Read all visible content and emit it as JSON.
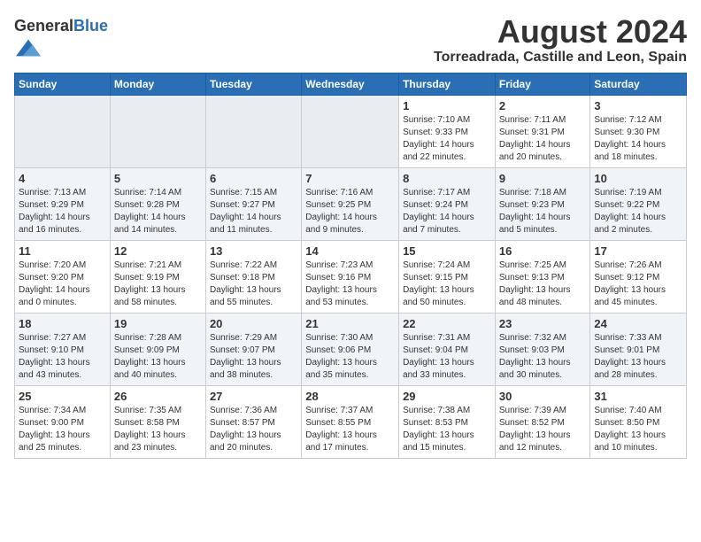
{
  "header": {
    "logo_general": "General",
    "logo_blue": "Blue",
    "month_year": "August 2024",
    "location": "Torreadrada, Castille and Leon, Spain"
  },
  "calendar": {
    "days_of_week": [
      "Sunday",
      "Monday",
      "Tuesday",
      "Wednesday",
      "Thursday",
      "Friday",
      "Saturday"
    ],
    "weeks": [
      [
        {
          "day": "",
          "info": ""
        },
        {
          "day": "",
          "info": ""
        },
        {
          "day": "",
          "info": ""
        },
        {
          "day": "",
          "info": ""
        },
        {
          "day": "1",
          "info": "Sunrise: 7:10 AM\nSunset: 9:33 PM\nDaylight: 14 hours\nand 22 minutes."
        },
        {
          "day": "2",
          "info": "Sunrise: 7:11 AM\nSunset: 9:31 PM\nDaylight: 14 hours\nand 20 minutes."
        },
        {
          "day": "3",
          "info": "Sunrise: 7:12 AM\nSunset: 9:30 PM\nDaylight: 14 hours\nand 18 minutes."
        }
      ],
      [
        {
          "day": "4",
          "info": "Sunrise: 7:13 AM\nSunset: 9:29 PM\nDaylight: 14 hours\nand 16 minutes."
        },
        {
          "day": "5",
          "info": "Sunrise: 7:14 AM\nSunset: 9:28 PM\nDaylight: 14 hours\nand 14 minutes."
        },
        {
          "day": "6",
          "info": "Sunrise: 7:15 AM\nSunset: 9:27 PM\nDaylight: 14 hours\nand 11 minutes."
        },
        {
          "day": "7",
          "info": "Sunrise: 7:16 AM\nSunset: 9:25 PM\nDaylight: 14 hours\nand 9 minutes."
        },
        {
          "day": "8",
          "info": "Sunrise: 7:17 AM\nSunset: 9:24 PM\nDaylight: 14 hours\nand 7 minutes."
        },
        {
          "day": "9",
          "info": "Sunrise: 7:18 AM\nSunset: 9:23 PM\nDaylight: 14 hours\nand 5 minutes."
        },
        {
          "day": "10",
          "info": "Sunrise: 7:19 AM\nSunset: 9:22 PM\nDaylight: 14 hours\nand 2 minutes."
        }
      ],
      [
        {
          "day": "11",
          "info": "Sunrise: 7:20 AM\nSunset: 9:20 PM\nDaylight: 14 hours\nand 0 minutes."
        },
        {
          "day": "12",
          "info": "Sunrise: 7:21 AM\nSunset: 9:19 PM\nDaylight: 13 hours\nand 58 minutes."
        },
        {
          "day": "13",
          "info": "Sunrise: 7:22 AM\nSunset: 9:18 PM\nDaylight: 13 hours\nand 55 minutes."
        },
        {
          "day": "14",
          "info": "Sunrise: 7:23 AM\nSunset: 9:16 PM\nDaylight: 13 hours\nand 53 minutes."
        },
        {
          "day": "15",
          "info": "Sunrise: 7:24 AM\nSunset: 9:15 PM\nDaylight: 13 hours\nand 50 minutes."
        },
        {
          "day": "16",
          "info": "Sunrise: 7:25 AM\nSunset: 9:13 PM\nDaylight: 13 hours\nand 48 minutes."
        },
        {
          "day": "17",
          "info": "Sunrise: 7:26 AM\nSunset: 9:12 PM\nDaylight: 13 hours\nand 45 minutes."
        }
      ],
      [
        {
          "day": "18",
          "info": "Sunrise: 7:27 AM\nSunset: 9:10 PM\nDaylight: 13 hours\nand 43 minutes."
        },
        {
          "day": "19",
          "info": "Sunrise: 7:28 AM\nSunset: 9:09 PM\nDaylight: 13 hours\nand 40 minutes."
        },
        {
          "day": "20",
          "info": "Sunrise: 7:29 AM\nSunset: 9:07 PM\nDaylight: 13 hours\nand 38 minutes."
        },
        {
          "day": "21",
          "info": "Sunrise: 7:30 AM\nSunset: 9:06 PM\nDaylight: 13 hours\nand 35 minutes."
        },
        {
          "day": "22",
          "info": "Sunrise: 7:31 AM\nSunset: 9:04 PM\nDaylight: 13 hours\nand 33 minutes."
        },
        {
          "day": "23",
          "info": "Sunrise: 7:32 AM\nSunset: 9:03 PM\nDaylight: 13 hours\nand 30 minutes."
        },
        {
          "day": "24",
          "info": "Sunrise: 7:33 AM\nSunset: 9:01 PM\nDaylight: 13 hours\nand 28 minutes."
        }
      ],
      [
        {
          "day": "25",
          "info": "Sunrise: 7:34 AM\nSunset: 9:00 PM\nDaylight: 13 hours\nand 25 minutes."
        },
        {
          "day": "26",
          "info": "Sunrise: 7:35 AM\nSunset: 8:58 PM\nDaylight: 13 hours\nand 23 minutes."
        },
        {
          "day": "27",
          "info": "Sunrise: 7:36 AM\nSunset: 8:57 PM\nDaylight: 13 hours\nand 20 minutes."
        },
        {
          "day": "28",
          "info": "Sunrise: 7:37 AM\nSunset: 8:55 PM\nDaylight: 13 hours\nand 17 minutes."
        },
        {
          "day": "29",
          "info": "Sunrise: 7:38 AM\nSunset: 8:53 PM\nDaylight: 13 hours\nand 15 minutes."
        },
        {
          "day": "30",
          "info": "Sunrise: 7:39 AM\nSunset: 8:52 PM\nDaylight: 13 hours\nand 12 minutes."
        },
        {
          "day": "31",
          "info": "Sunrise: 7:40 AM\nSunset: 8:50 PM\nDaylight: 13 hours\nand 10 minutes."
        }
      ]
    ]
  }
}
